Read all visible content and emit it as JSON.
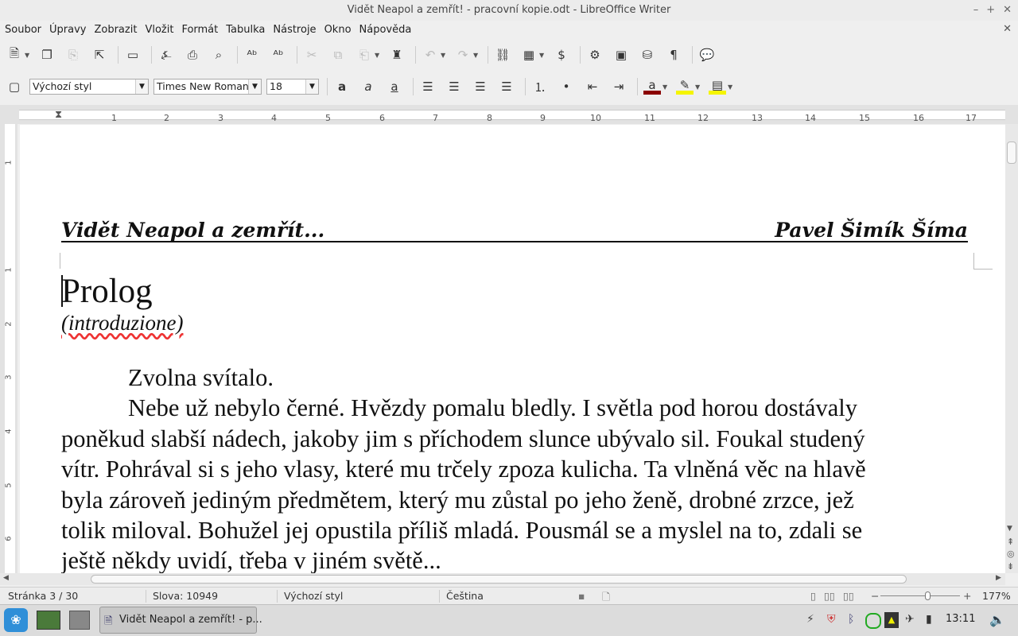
{
  "window": {
    "title": "Vidět Neapol a zemřít! - pracovní kopie.odt - LibreOffice Writer",
    "controls": [
      "–",
      "+",
      "✕"
    ]
  },
  "menu": [
    "Soubor",
    "Úpravy",
    "Zobrazit",
    "Vložit",
    "Formát",
    "Tabulka",
    "Nástroje",
    "Okno",
    "Nápověda"
  ],
  "formatting": {
    "paragraph_style": "Výchozí styl",
    "font_name": "Times New Roman",
    "font_size": "18",
    "font_color": "#8b0000",
    "highlight_color": "#f5f500"
  },
  "ruler": {
    "numbers": [
      "1",
      "2",
      "3",
      "4",
      "5",
      "6",
      "7",
      "8",
      "9",
      "10",
      "11",
      "12",
      "13",
      "14",
      "15",
      "16",
      "17"
    ],
    "vertical_numbers": [
      "1",
      "1",
      "2",
      "3",
      "4",
      "5",
      "6"
    ]
  },
  "document": {
    "header_left": "Vidět Neapol a zemřít...",
    "header_right": "Pavel Šimík Šíma",
    "heading": "Prolog",
    "subheading": "(introduzione)",
    "lines": [
      "Zvolna svítalo.",
      "Nebe už nebylo černé. Hvězdy pomalu bledly. I světla pod horou dostávaly",
      "poněkud slabší nádech, jakoby jim s příchodem slunce ubývalo sil. Foukal studený",
      "vítr. Pohrával si s jeho vlasy, které mu trčely zpoza kulicha. Ta vlněná věc na hlavě",
      "byla zároveň jediným předmětem, který mu zůstal po jeho ženě, drobné zrzce, jež",
      "tolik miloval. Bohužel jej opustila příliš mladá. Pousmál se a myslel na to, zdali se",
      "ještě někdy uvidí, třeba v jiném světě..."
    ]
  },
  "status": {
    "page": "Stránka 3 / 30",
    "words": "Slova: 10949",
    "style": "Výchozí styl",
    "language": "Čeština",
    "zoom_percent": "177%",
    "zoom_level": 0.6
  },
  "taskbar": {
    "active_window": "Vidět Neapol a zemřít! - p...",
    "clock": "13:11"
  }
}
